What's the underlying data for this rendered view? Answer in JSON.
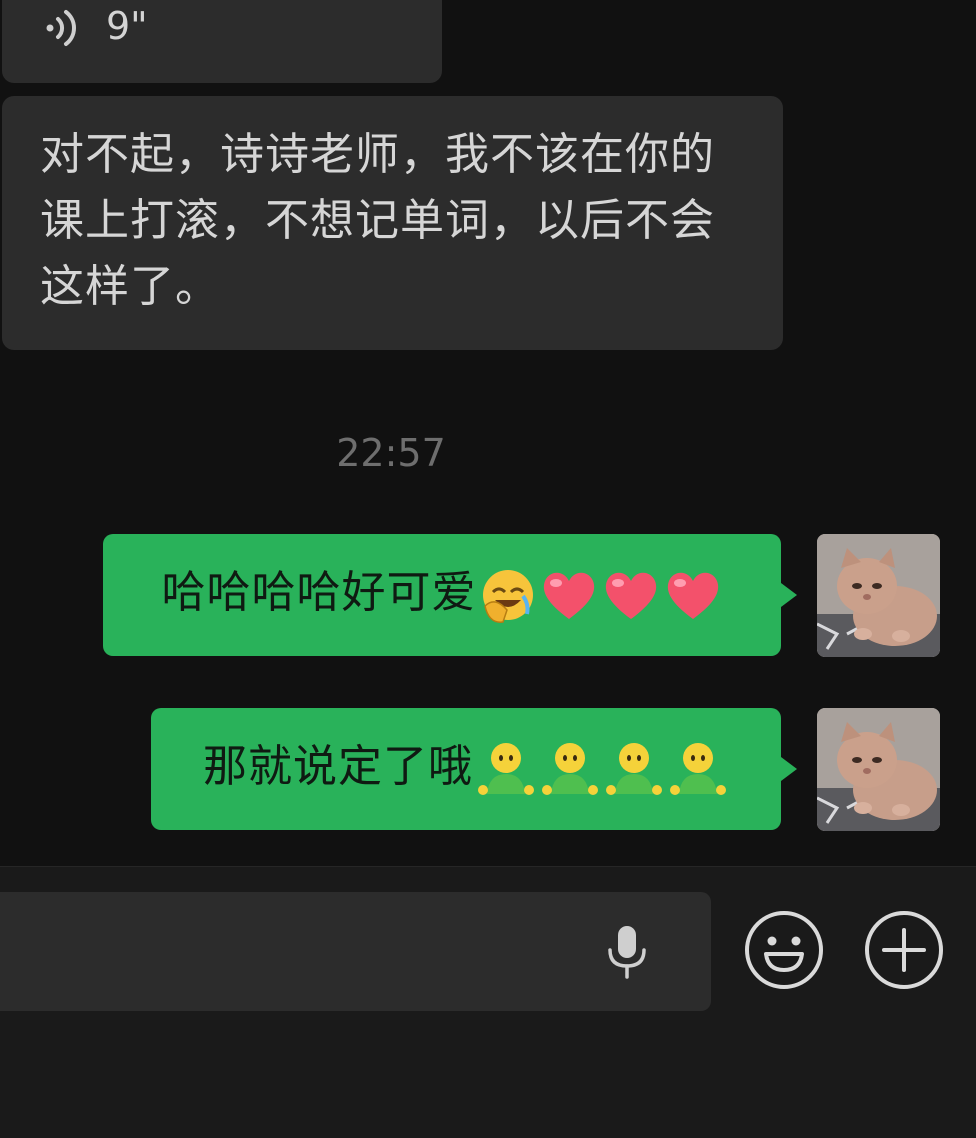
{
  "received": {
    "voice": {
      "icon": "voice-wave-icon",
      "duration": "9\""
    },
    "text_message": "对不起，诗诗老师，我不该在你的课上打滚，不想记单词，以后不会这样了。"
  },
  "timestamp": "22:57",
  "sent": [
    {
      "text": "哈哈哈哈好可爱",
      "emojis": [
        "face-palm-laugh-emoji",
        "heart-emoji",
        "heart-emoji",
        "heart-emoji"
      ],
      "avatar": "cat-avatar"
    },
    {
      "text": "那就说定了哦",
      "emojis": [
        "green-figure-emoji",
        "green-figure-emoji",
        "green-figure-emoji",
        "green-figure-emoji"
      ],
      "avatar": "cat-avatar"
    }
  ],
  "input_bar": {
    "placeholder": "",
    "icons": [
      "microphone-icon",
      "emoji-smile-icon",
      "add-plus-icon"
    ]
  },
  "colors": {
    "background": "#111111",
    "received_bubble": "#2c2c2c",
    "sent_bubble": "#29b25a",
    "input_bar": "#1a1a1a"
  }
}
